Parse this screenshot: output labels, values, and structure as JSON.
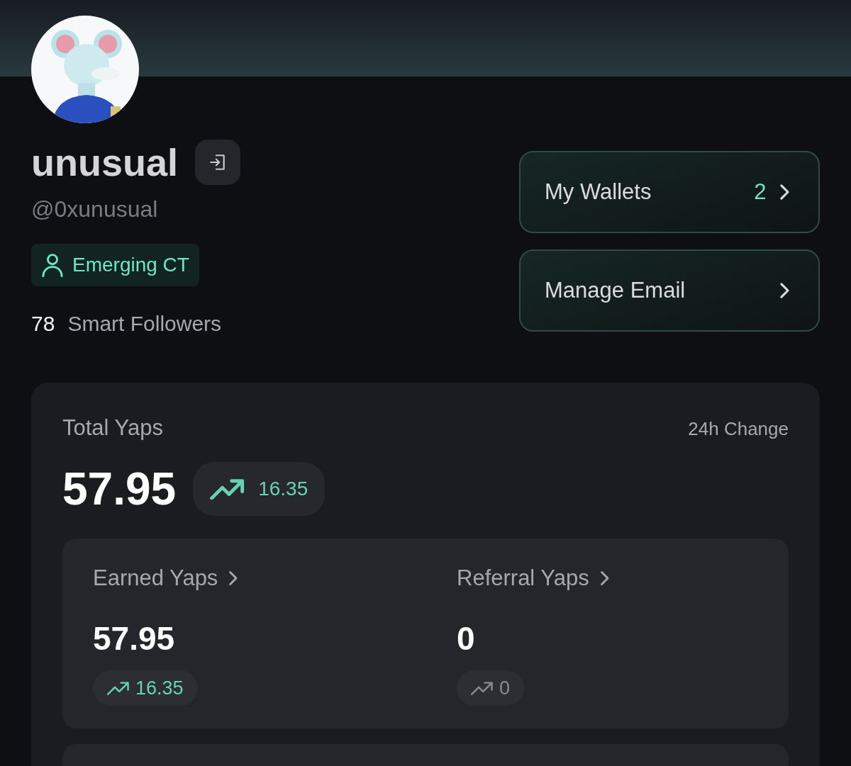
{
  "profile": {
    "name": "unusual",
    "handle": "@0xunusual",
    "badge": "Emerging CT",
    "followers_count": "78",
    "followers_label": "Smart Followers"
  },
  "actions": [
    {
      "label": "My Wallets",
      "count": "2"
    },
    {
      "label": "Manage Email"
    }
  ],
  "summary": {
    "title": "Total Yaps",
    "change_label": "24h Change",
    "total": "57.95",
    "change": {
      "value": "16.35",
      "positive": true
    },
    "breakdown": [
      {
        "label": "Earned Yaps",
        "value": "57.95",
        "change": {
          "value": "16.35",
          "positive": true
        }
      },
      {
        "label": "Referral Yaps",
        "value": "0",
        "change": {
          "value": "0",
          "positive": false
        }
      }
    ]
  }
}
